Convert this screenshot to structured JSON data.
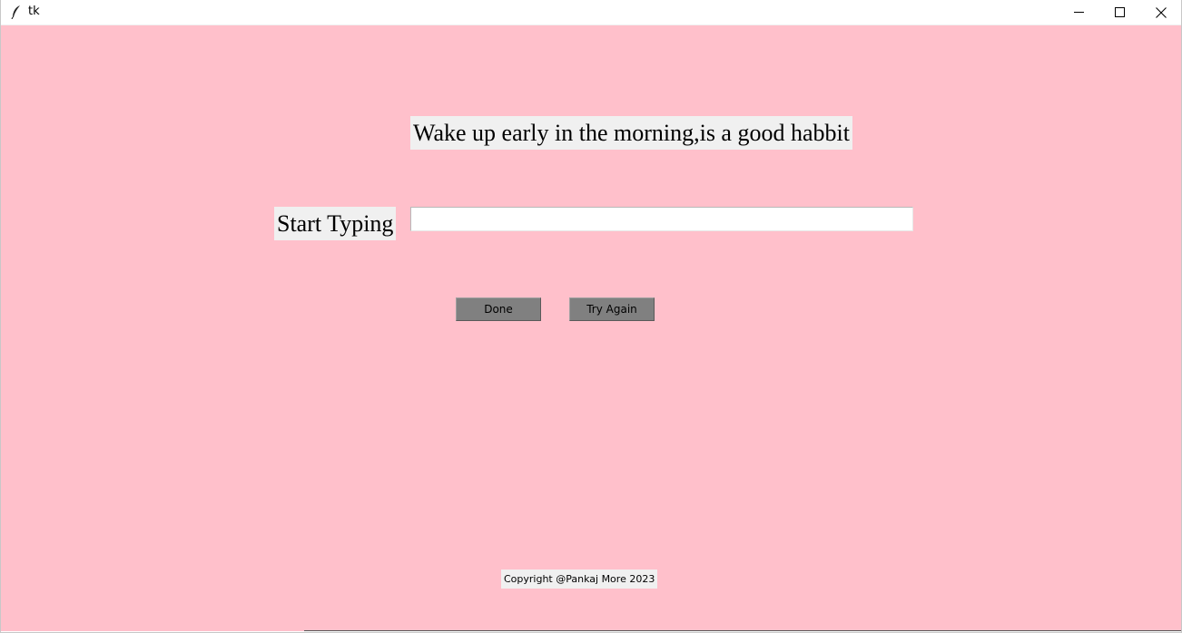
{
  "window": {
    "title": "tk",
    "icon": "feather-icon",
    "controls": {
      "minimize": "minimize-icon",
      "maximize": "maximize-icon",
      "close": "close-icon"
    }
  },
  "colors": {
    "background": "#ffc0cb",
    "label_background": "#f0f0f0",
    "button_background": "#808080"
  },
  "main": {
    "sentence": "Wake up early in the morning,is a good habbit",
    "start_label": "Start Typing",
    "typing_input": {
      "value": "",
      "placeholder": ""
    },
    "done_label": "Done",
    "try_again_label": "Try Again",
    "copyright": "Copyright @Pankaj More 2023"
  }
}
